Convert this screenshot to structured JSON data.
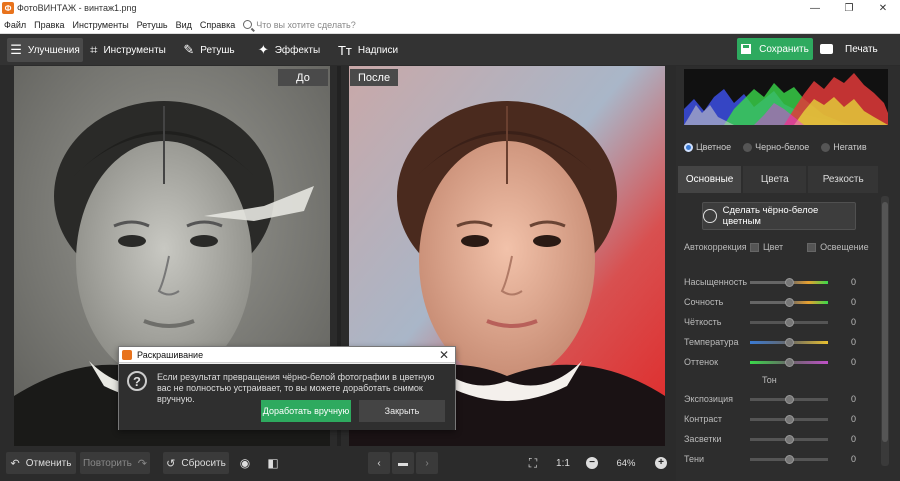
{
  "window": {
    "title": "ФотоВИНТАЖ - винтаж1.png",
    "controls": [
      "—",
      "❐",
      "✕"
    ]
  },
  "menu": {
    "items": [
      "Файл",
      "Правка",
      "Инструменты",
      "Ретушь",
      "Вид",
      "Справка"
    ],
    "search_placeholder": "Что вы хотите сделать?"
  },
  "toolbar": {
    "tabs": [
      {
        "label": "Улучшения",
        "icon": "sliders-icon",
        "glyph": "☰"
      },
      {
        "label": "Инструменты",
        "icon": "crop-icon",
        "glyph": "⌗"
      },
      {
        "label": "Ретушь",
        "icon": "brush-icon",
        "glyph": "✎"
      },
      {
        "label": "Эффекты",
        "icon": "magic-wand-icon",
        "glyph": "✦"
      },
      {
        "label": "Надписи",
        "icon": "text-icon",
        "glyph": "Tт"
      }
    ],
    "save_label": "Сохранить",
    "print_label": "Печать"
  },
  "preview": {
    "before_label": "До",
    "after_label": "После"
  },
  "right_panel": {
    "color_modes": [
      "Цветное",
      "Черно-белое",
      "Негатив"
    ],
    "selected_mode": "Цветное",
    "tabs": [
      "Основные",
      "Цвета",
      "Резкость"
    ],
    "colorize_label": "Сделать чёрно-белое цветным",
    "autocorrection": {
      "label": "Автокоррекция",
      "options": [
        "Цвет",
        "Освещение"
      ]
    },
    "sliders": [
      {
        "label": "Насыщенность",
        "value": "0"
      },
      {
        "label": "Сочность",
        "value": "0"
      },
      {
        "label": "Чёткость",
        "value": "0"
      },
      {
        "label": "Температура",
        "value": "0"
      },
      {
        "label": "Оттенок",
        "value": "0"
      }
    ],
    "tone_section_label": "Тон",
    "tone_sliders": [
      {
        "label": "Экспозиция",
        "value": "0"
      },
      {
        "label": "Контраст",
        "value": "0"
      },
      {
        "label": "Засветки",
        "value": "0"
      },
      {
        "label": "Тени",
        "value": "0"
      }
    ]
  },
  "bottom": {
    "undo_label": "Отменить",
    "redo_label": "Повторить",
    "reset_label": "Сбросить",
    "ratio_label": "1:1",
    "zoom_value": "64%",
    "zoom_minus": "−",
    "zoom_plus": "+"
  },
  "dialog": {
    "title": "Раскрашивание",
    "message": "Если результат превращения чёрно-белой фотографии в цветную вас не полностью устраивает, то вы можете доработать снимок вручную.",
    "primary_label": "Доработать вручную",
    "secondary_label": "Закрыть"
  },
  "colors": {
    "accent_green": "#2eaa5f",
    "app_orange": "#e8731c",
    "radio_blue": "#3a7bd5"
  }
}
